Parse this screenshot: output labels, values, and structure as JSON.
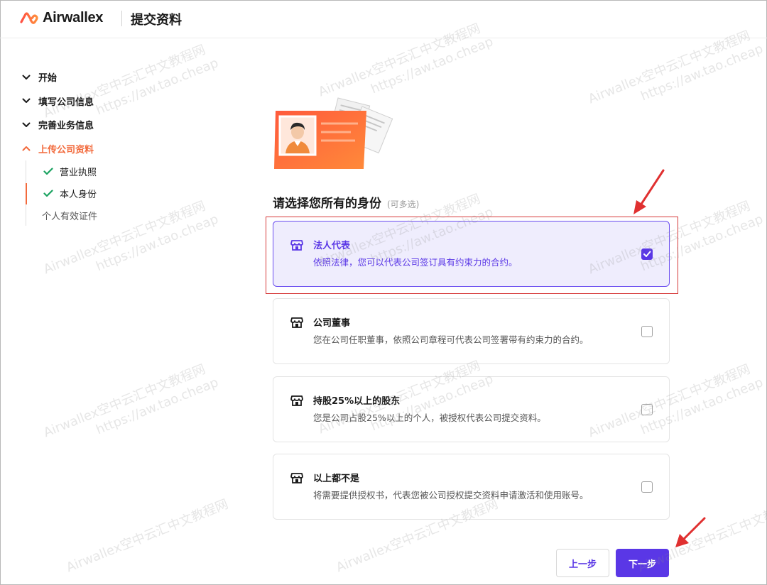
{
  "header": {
    "logo_text": "Airwallex",
    "title": "提交资料"
  },
  "nav": {
    "items": [
      {
        "label": "开始",
        "state": "collapsed"
      },
      {
        "label": "填写公司信息",
        "state": "collapsed"
      },
      {
        "label": "完善业务信息",
        "state": "collapsed"
      },
      {
        "label": "上传公司资料",
        "state": "expanded"
      }
    ],
    "sub_items": [
      {
        "label": "营业执照",
        "status": "done"
      },
      {
        "label": "本人身份",
        "status": "done"
      },
      {
        "label": "个人有效证件",
        "status": "pending"
      }
    ]
  },
  "main": {
    "section_title": "请选择您所有的身份",
    "section_hint": "(可多选)",
    "options": [
      {
        "title": "法人代表",
        "desc": "依照法律，您可以代表公司签订具有约束力的合约。",
        "checked": true
      },
      {
        "title": "公司董事",
        "desc": "您在公司任职董事，依照公司章程可代表公司签署带有约束力的合约。",
        "checked": false
      },
      {
        "title": "持股25%以上的股东",
        "desc": "您是公司占股25%以上的个人，被授权代表公司提交资料。",
        "checked": false
      },
      {
        "title": "以上都不是",
        "desc": "将需要提供授权书，代表您被公司授权提交资料申请激活和使用账号。",
        "checked": false
      }
    ]
  },
  "footer": {
    "prev_label": "上一步",
    "next_label": "下一步"
  },
  "watermark": {
    "line1": "Airwallex空中云汇中文教程网",
    "line2": "https://aw.tao.cheap"
  },
  "colors": {
    "accent": "#5a37e6",
    "brand_orange": "#f26a3c",
    "selected_bg": "#efedfd",
    "annotation_red": "#e03030"
  }
}
